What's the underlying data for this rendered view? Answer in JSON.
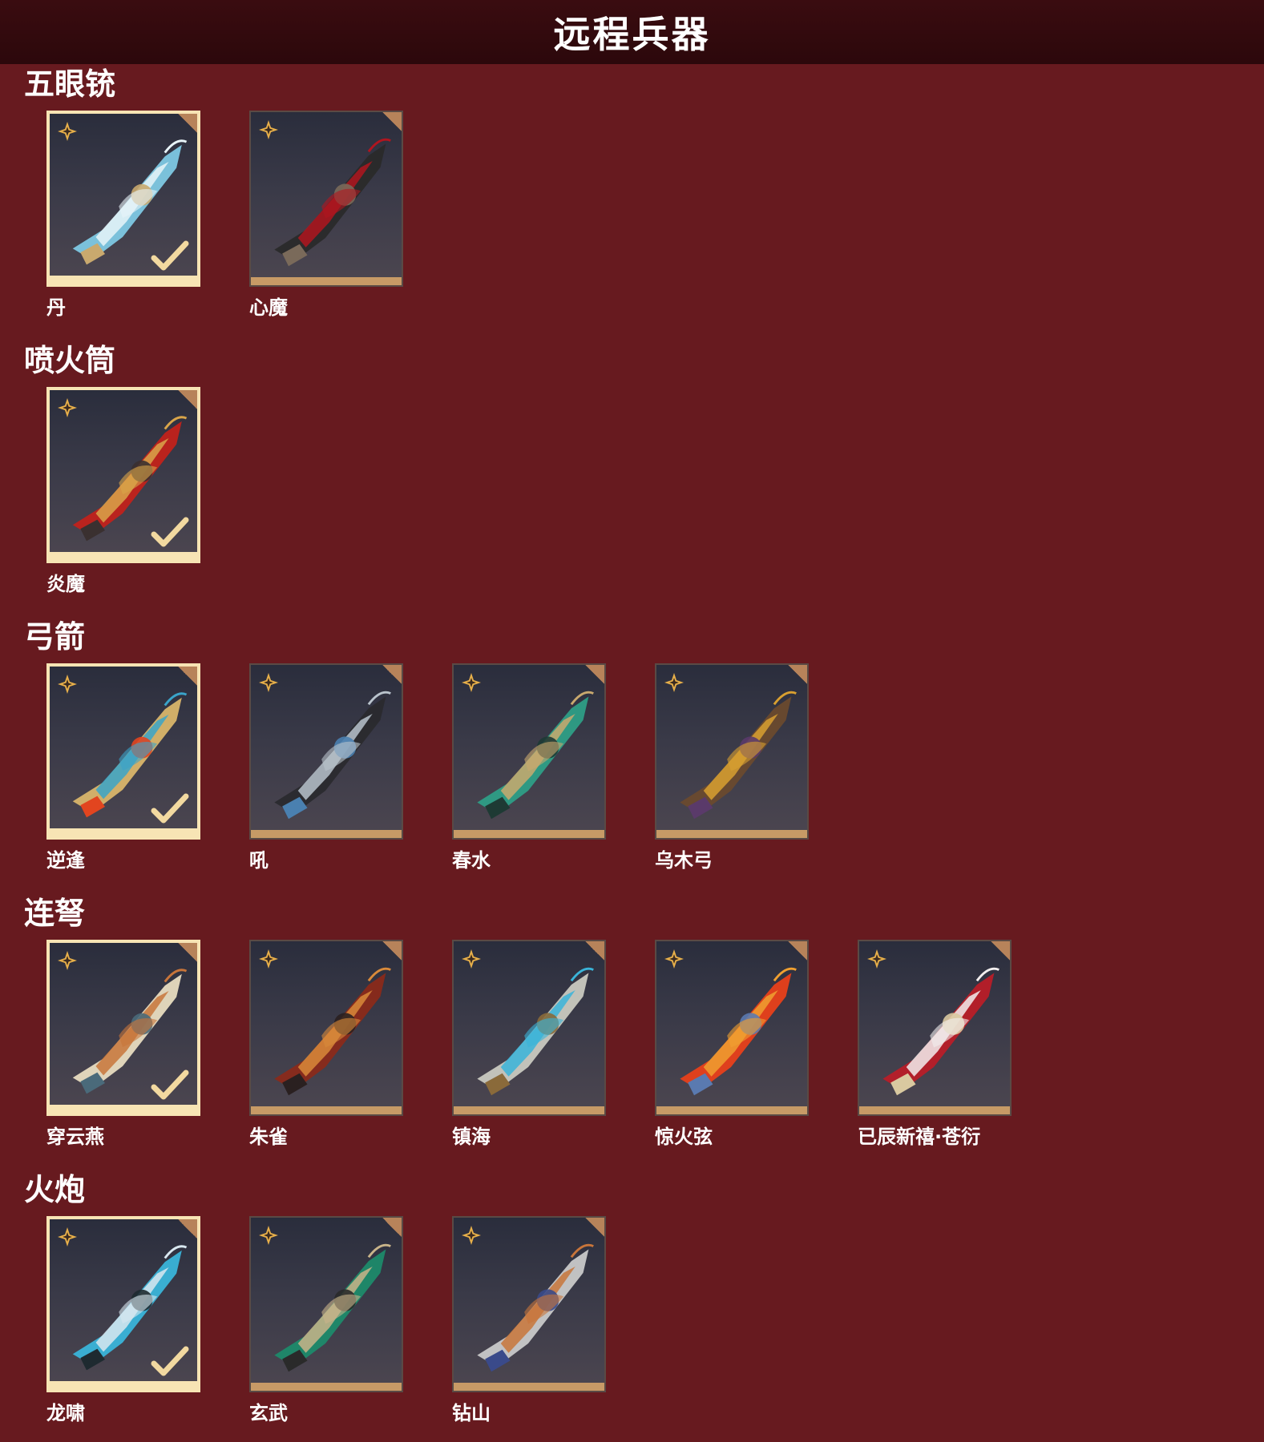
{
  "header": {
    "title": "远程兵器"
  },
  "sections": [
    {
      "title": "五眼铳",
      "items": [
        {
          "name": "丹",
          "owned": true,
          "art": "blue-white-pistol",
          "c1": "#7ec8e3",
          "c2": "#e8f4f8",
          "c3": "#c9a96e"
        },
        {
          "name": "心魔",
          "owned": false,
          "art": "dark-red-pistol",
          "c1": "#2a2a2a",
          "c2": "#b0151f",
          "c3": "#7a6a5a"
        }
      ]
    },
    {
      "title": "喷火筒",
      "items": [
        {
          "name": "炎魔",
          "owned": true,
          "art": "red-gold-cannon",
          "c1": "#c1221b",
          "c2": "#d9a54a",
          "c3": "#3a3030"
        }
      ]
    },
    {
      "title": "弓箭",
      "items": [
        {
          "name": "逆逢",
          "owned": true,
          "art": "gold-blue-bow",
          "c1": "#d9b56a",
          "c2": "#3aa4c9",
          "c3": "#e2451f"
        },
        {
          "name": "吼",
          "owned": false,
          "art": "black-silver-bow",
          "c1": "#2a2a2e",
          "c2": "#b9c3cc",
          "c3": "#4a80b0"
        },
        {
          "name": "春水",
          "owned": false,
          "art": "green-bow",
          "c1": "#2e9e86",
          "c2": "#c9a96e",
          "c3": "#1e3a34"
        },
        {
          "name": "乌木弓",
          "owned": false,
          "art": "wood-bow",
          "c1": "#6a4a2e",
          "c2": "#d9a030",
          "c3": "#5a3a6a"
        }
      ]
    },
    {
      "title": "连弩",
      "items": [
        {
          "name": "穿云燕",
          "owned": true,
          "art": "cream-crossbow",
          "c1": "#e8dcc0",
          "c2": "#c8753a",
          "c3": "#4a6a7a"
        },
        {
          "name": "朱雀",
          "owned": false,
          "art": "red-crossbow",
          "c1": "#8a2a1a",
          "c2": "#d98a3a",
          "c3": "#2a2020"
        },
        {
          "name": "镇海",
          "owned": false,
          "art": "silver-crossbow",
          "c1": "#c9c9c0",
          "c2": "#3ab4d9",
          "c3": "#8a6a3a"
        },
        {
          "name": "惊火弦",
          "owned": false,
          "art": "fire-crossbow",
          "c1": "#e8401a",
          "c2": "#f0a030",
          "c3": "#5a7ab0"
        },
        {
          "name": "已辰新禧·苍衍",
          "owned": false,
          "art": "red-white-crossbow",
          "c1": "#b81e28",
          "c2": "#f2eeee",
          "c3": "#d9c9a0"
        }
      ]
    },
    {
      "title": "火炮",
      "items": [
        {
          "name": "龙啸",
          "owned": true,
          "art": "dragon-cannon",
          "c1": "#3ab4d9",
          "c2": "#d9e8f0",
          "c3": "#1e2a30"
        },
        {
          "name": "玄武",
          "owned": false,
          "art": "green-cannon",
          "c1": "#1e8a6a",
          "c2": "#c9b48a",
          "c3": "#2a2a2a"
        },
        {
          "name": "钻山",
          "owned": false,
          "art": "silver-cannon",
          "c1": "#c9c9c9",
          "c2": "#c8753a",
          "c3": "#3a4a8a"
        }
      ]
    }
  ],
  "icons": {
    "rarity": "rarity-star-icon",
    "owned": "checkmark-icon"
  }
}
